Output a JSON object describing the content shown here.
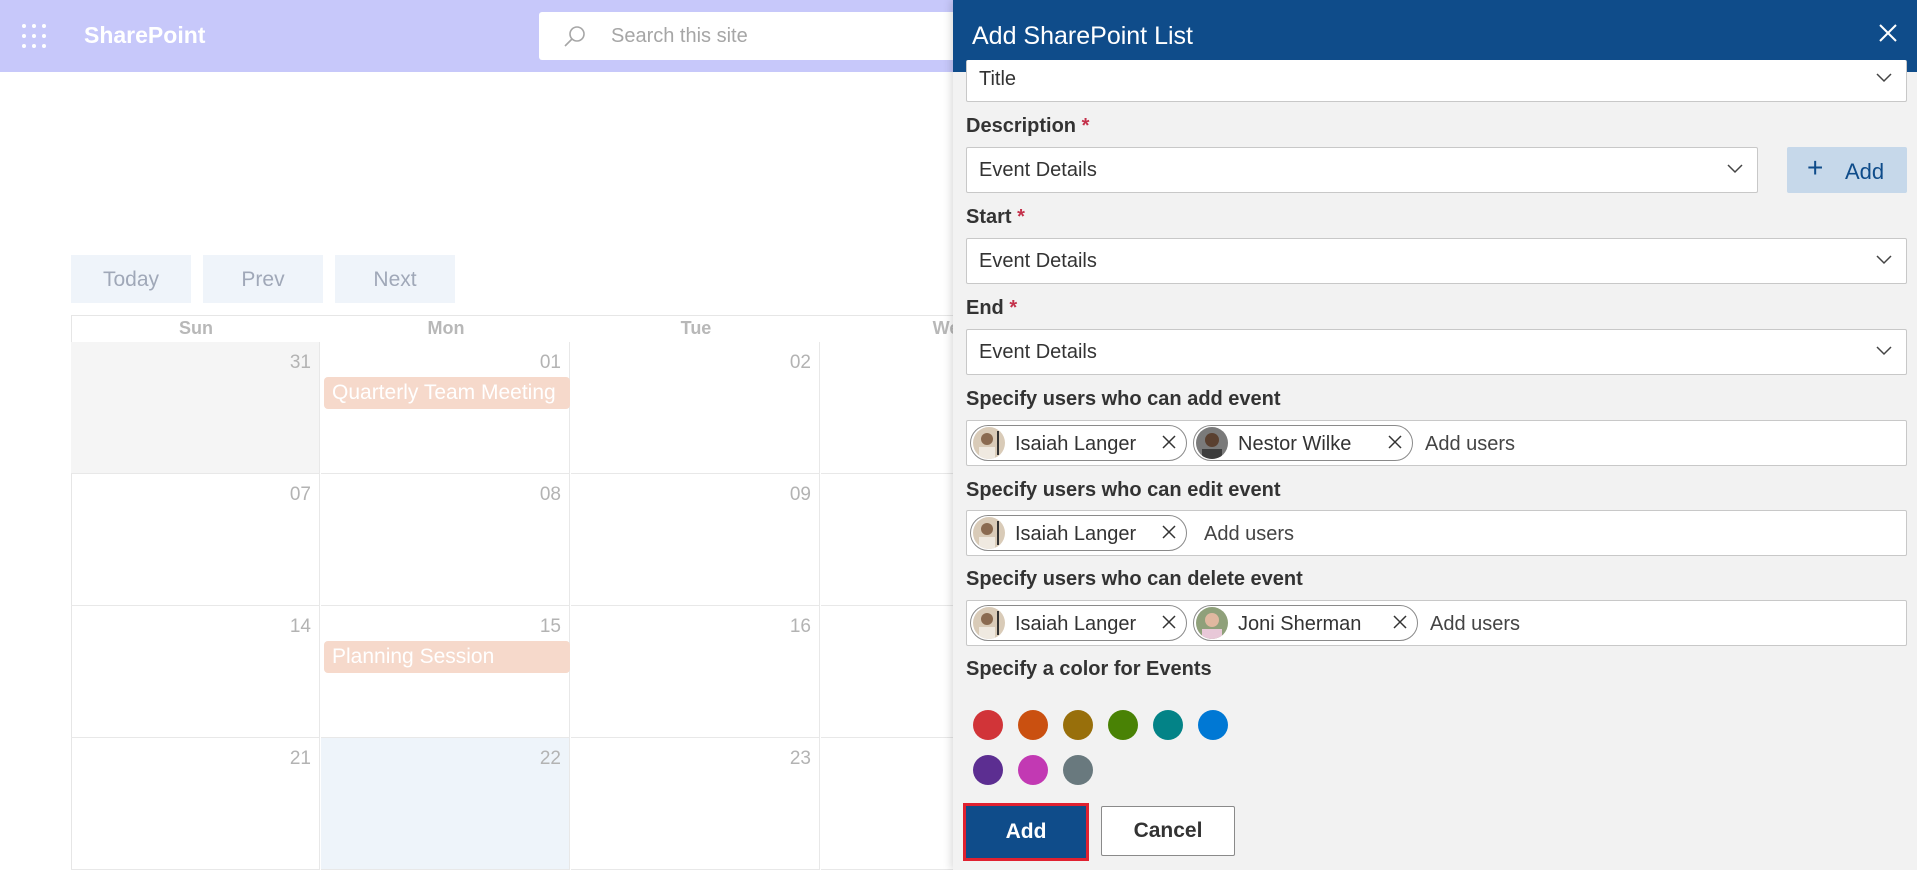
{
  "app": {
    "name": "SharePoint"
  },
  "search": {
    "placeholder": "Search this site"
  },
  "calendar": {
    "nav": {
      "today": "Today",
      "prev": "Prev",
      "next": "Next"
    },
    "days": [
      "Sun",
      "Mon",
      "Tue",
      "We"
    ],
    "weeks": [
      [
        "31",
        "01",
        "02"
      ],
      [
        "07",
        "08",
        "09"
      ],
      [
        "14",
        "15",
        "16"
      ],
      [
        "21",
        "22",
        "23"
      ]
    ],
    "events": [
      {
        "title": "Quarterly Team Meeting"
      },
      {
        "title": "Planning Session"
      }
    ]
  },
  "panel": {
    "title": "Add SharePoint List",
    "title_field_value": "Title",
    "description": {
      "label": "Description",
      "required": "*",
      "value": "Event Details",
      "add_label": "Add"
    },
    "start": {
      "label": "Start",
      "required": "*",
      "value": "Event Details"
    },
    "end": {
      "label": "End",
      "required": "*",
      "value": "Event Details"
    },
    "add_users": {
      "label": "Specify users who can add event",
      "people": [
        "Isaiah Langer",
        "Nestor Wilke"
      ],
      "placeholder": "Add users"
    },
    "edit_users": {
      "label": "Specify users who can edit event",
      "people": [
        "Isaiah Langer"
      ],
      "placeholder": "Add users"
    },
    "delete_users": {
      "label": "Specify users who can delete event",
      "people": [
        "Isaiah Langer",
        "Joni Sherman"
      ],
      "placeholder": "Add users"
    },
    "color": {
      "label": "Specify a color for Events",
      "swatches": [
        "#d13438",
        "#ca5010",
        "#986f0b",
        "#498205",
        "#038387",
        "#0078d4",
        "#5c2e91",
        "#c239b3",
        "#69797e"
      ]
    },
    "buttons": {
      "primary": "Add",
      "cancel": "Cancel"
    }
  }
}
